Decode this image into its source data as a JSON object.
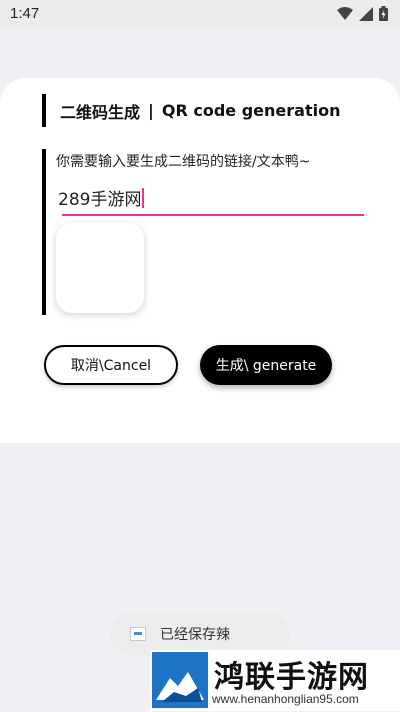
{
  "status_bar": {
    "time": "1:47"
  },
  "dialog": {
    "title_cn": "二维码生成",
    "title_sep": "|",
    "title_en": "QR code generation",
    "prompt": "你需要输入要生成二维码的链接/文本鸭~",
    "input_value": "289手游网",
    "cancel_label": "取消\\Cancel",
    "generate_label": "生成\\ generate"
  },
  "toast": {
    "message": "已经保存辣"
  },
  "watermark": {
    "title": "鸿联手游网",
    "url": "www.henanhonglian95.com"
  },
  "colors": {
    "accent": "#e63b8a",
    "background": "#efeff4",
    "card": "#ffffff",
    "primary_button": "#000000"
  }
}
